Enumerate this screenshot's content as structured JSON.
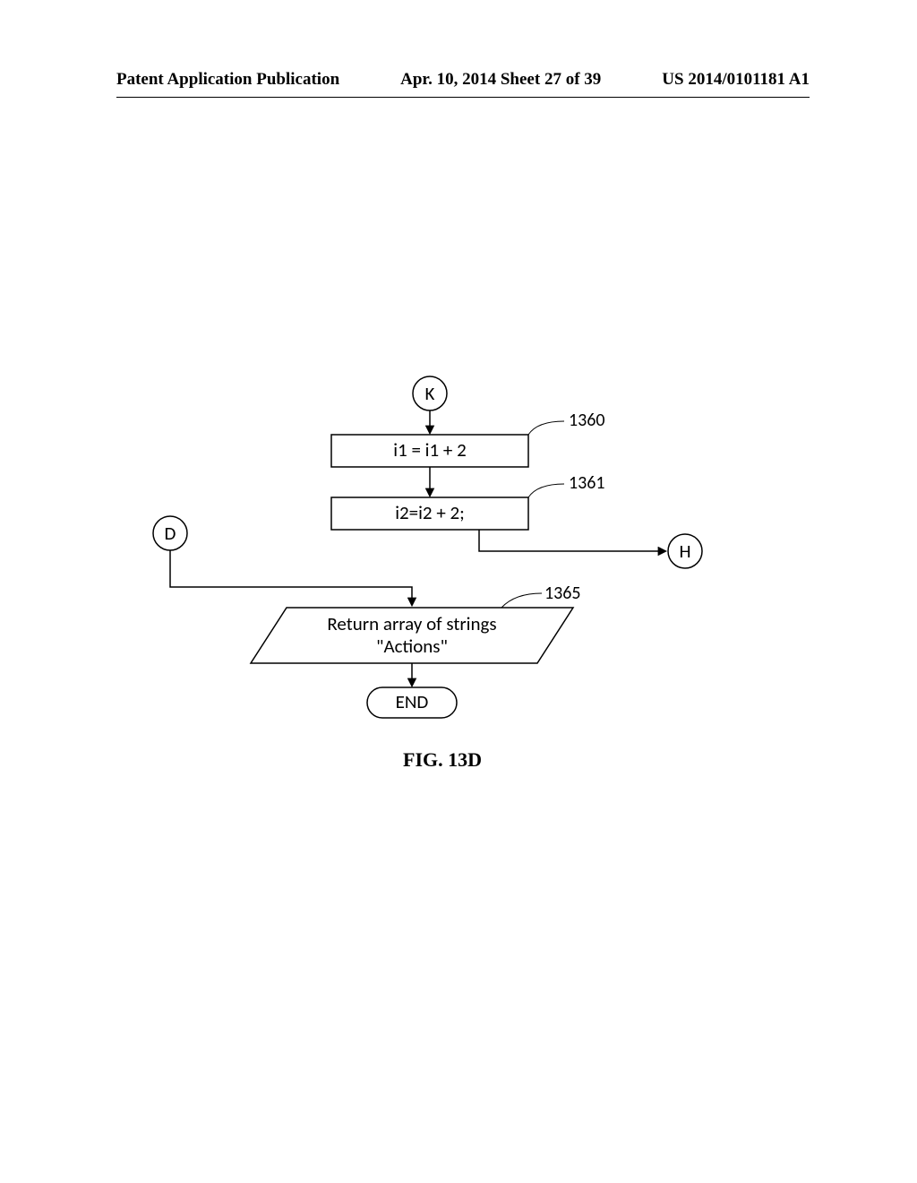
{
  "header": {
    "left": "Patent Application Publication",
    "center": "Apr. 10, 2014  Sheet 27 of 39",
    "right": "US 2014/0101181 A1"
  },
  "figure": {
    "label": "FIG. 13D",
    "connectors": {
      "k": "K",
      "d": "D",
      "h": "H"
    },
    "steps": {
      "s1360": {
        "ref": "1360",
        "text": "i1 = i1 + 2"
      },
      "s1361": {
        "ref": "1361",
        "text": "i2=i2 + 2;"
      },
      "s1365": {
        "ref": "1365",
        "line1": "Return array of strings",
        "line2": "\"Actions\""
      }
    },
    "terminator": "END"
  }
}
